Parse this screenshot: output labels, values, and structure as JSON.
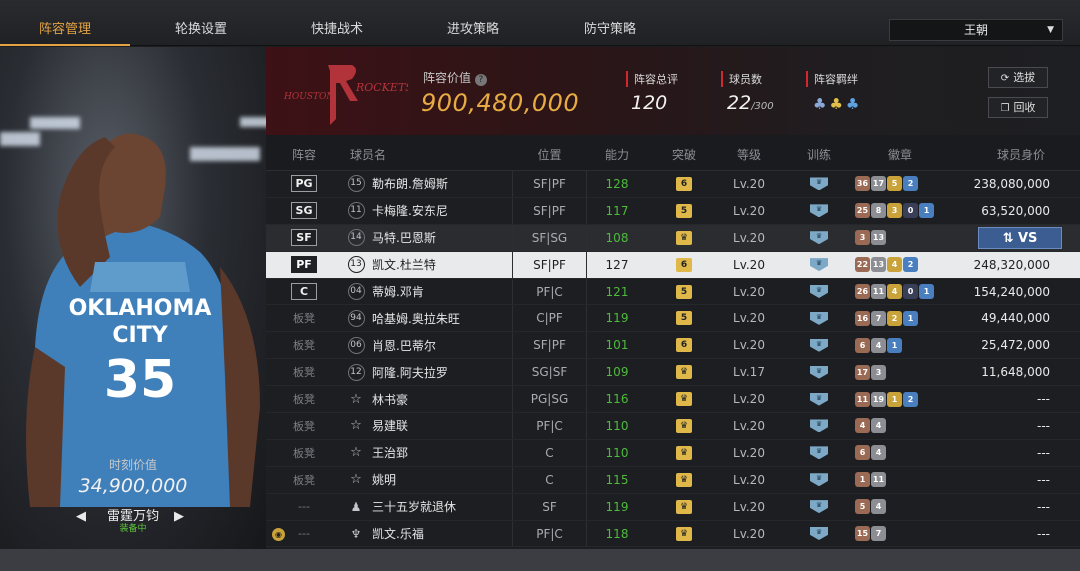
{
  "tabs": [
    "阵容管理",
    "轮换设置",
    "快捷战术",
    "进攻策略",
    "防守策略"
  ],
  "team_select": "王朝",
  "card": {
    "value_label": "时刻价值",
    "value": "34,900,000",
    "name": "雷霆万钧",
    "status": "装备中"
  },
  "summary": {
    "value_label": "阵容价值",
    "value": "900,480,000",
    "rating_label": "阵容总评",
    "rating": "120",
    "count_label": "球员数",
    "count": "22",
    "count_max": "/300",
    "bond_label": "阵容羁绊",
    "select_btn": "选拔",
    "recycle_btn": "回收"
  },
  "headers": [
    "阵容",
    "球员名",
    "位置",
    "能力",
    "突破",
    "等级",
    "训练",
    "徽章",
    "球员身价"
  ],
  "vs_label": "VS",
  "rows": [
    {
      "pos": "PG",
      "num": "15",
      "name": "勒布朗.詹姆斯",
      "p": "SF|PF",
      "abl": "128",
      "brk": "6",
      "lvl": "Lv.20",
      "badges": [
        [
          "36",
          "b"
        ],
        [
          "17",
          "s"
        ],
        [
          "5",
          "g"
        ],
        [
          "2",
          "h"
        ]
      ],
      "val": "238,080,000"
    },
    {
      "pos": "SG",
      "num": "11",
      "name": "卡梅隆.安东尼",
      "p": "SF|PF",
      "abl": "117",
      "brk": "5",
      "lvl": "Lv.20",
      "badges": [
        [
          "25",
          "b"
        ],
        [
          "8",
          "s"
        ],
        [
          "3",
          "g"
        ],
        [
          "0",
          "p"
        ],
        [
          "1",
          "h"
        ]
      ],
      "val": "63,520,000"
    },
    {
      "pos": "SF",
      "num": "14",
      "name": "马特.巴恩斯",
      "p": "SF|SG",
      "abl": "108",
      "brk": "crown",
      "lvl": "Lv.20",
      "badges": [
        [
          "3",
          "b"
        ],
        [
          "13",
          "s"
        ]
      ],
      "val": ""
    },
    {
      "pos": "PF",
      "num": "13",
      "name": "凯文.杜兰特",
      "p": "SF|PF",
      "abl": "127",
      "brk": "6",
      "lvl": "Lv.20",
      "badges": [
        [
          "22",
          "b"
        ],
        [
          "13",
          "s"
        ],
        [
          "4",
          "g"
        ],
        [
          "2",
          "h"
        ]
      ],
      "val": "248,320,000"
    },
    {
      "pos": "C",
      "num": "04",
      "name": "蒂姆.邓肯",
      "p": "PF|C",
      "abl": "121",
      "brk": "5",
      "lvl": "Lv.20",
      "badges": [
        [
          "26",
          "b"
        ],
        [
          "11",
          "s"
        ],
        [
          "4",
          "g"
        ],
        [
          "0",
          "p"
        ],
        [
          "1",
          "h"
        ]
      ],
      "val": "154,240,000"
    },
    {
      "pos": "板凳",
      "num": "94",
      "name": "哈基姆.奥拉朱旺",
      "p": "C|PF",
      "abl": "119",
      "brk": "5",
      "lvl": "Lv.20",
      "badges": [
        [
          "16",
          "b"
        ],
        [
          "7",
          "s"
        ],
        [
          "2",
          "g"
        ],
        [
          "1",
          "h"
        ]
      ],
      "val": "49,440,000"
    },
    {
      "pos": "板凳",
      "num": "06",
      "name": "肖恩.巴蒂尔",
      "p": "SF|PF",
      "abl": "101",
      "brk": "6",
      "lvl": "Lv.20",
      "badges": [
        [
          "6",
          "b"
        ],
        [
          "4",
          "s"
        ],
        [
          "1",
          "h"
        ]
      ],
      "val": "25,472,000"
    },
    {
      "pos": "板凳",
      "num": "12",
      "name": "阿隆.阿夫拉罗",
      "p": "SG|SF",
      "abl": "109",
      "brk": "crown",
      "lvl": "Lv.17",
      "badges": [
        [
          "17",
          "b"
        ],
        [
          "3",
          "s"
        ]
      ],
      "val": "11,648,000"
    },
    {
      "pos": "板凳",
      "num": "star",
      "name": "林书豪",
      "p": "PG|SG",
      "abl": "116",
      "brk": "crown",
      "lvl": "Lv.20",
      "badges": [
        [
          "11",
          "b"
        ],
        [
          "19",
          "s"
        ],
        [
          "1",
          "g"
        ],
        [
          "2",
          "h"
        ]
      ],
      "val": "---"
    },
    {
      "pos": "板凳",
      "num": "star",
      "name": "易建联",
      "p": "PF|C",
      "abl": "110",
      "brk": "crown",
      "lvl": "Lv.20",
      "badges": [
        [
          "4",
          "b"
        ],
        [
          "4",
          "s"
        ]
      ],
      "val": "---"
    },
    {
      "pos": "板凳",
      "num": "star",
      "name": "王治郅",
      "p": "C",
      "abl": "110",
      "brk": "crown",
      "lvl": "Lv.20",
      "badges": [
        [
          "6",
          "b"
        ],
        [
          "4",
          "s"
        ]
      ],
      "val": "---"
    },
    {
      "pos": "板凳",
      "num": "star",
      "name": "姚明",
      "p": "C",
      "abl": "115",
      "brk": "crown",
      "lvl": "Lv.20",
      "badges": [
        [
          "1",
          "b"
        ],
        [
          "11",
          "s"
        ]
      ],
      "val": "---"
    },
    {
      "pos": "---",
      "num": "person",
      "name": "三十五岁就退休",
      "p": "SF",
      "abl": "119",
      "brk": "crown",
      "lvl": "Lv.20",
      "badges": [
        [
          "5",
          "b"
        ],
        [
          "4",
          "s"
        ]
      ],
      "val": "---"
    },
    {
      "pos": "---",
      "num": "trophy",
      "name": "凯文.乐福",
      "p": "PF|C",
      "abl": "118",
      "brk": "crown",
      "lvl": "Lv.20",
      "badges": [
        [
          "15",
          "b"
        ],
        [
          "7",
          "s"
        ]
      ],
      "val": "---"
    }
  ],
  "colors": {
    "accent": "#e3a344",
    "green": "#4dbb3c",
    "rockets_red": "#d2272d"
  }
}
